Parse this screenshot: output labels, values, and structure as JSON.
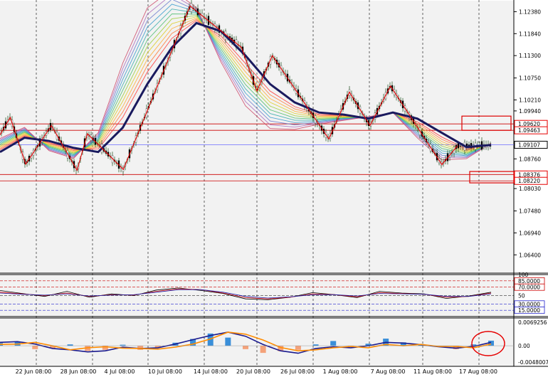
{
  "chart_data": [
    {
      "type": "line",
      "panel": "price",
      "description_layers": [
        "candlestick",
        "moving-average ribbon",
        "zigzag"
      ],
      "x": [
        "22 Jun 08:00",
        "28 Jun 08:00",
        "4 Jul 08:00",
        "10 Jul 08:00",
        "14 Jul 08:00",
        "20 Jul 08:00",
        "26 Jul 08:00",
        "1 Aug 08:00",
        "7 Aug 08:00",
        "11 Aug 08:00",
        "17 Aug 08:00"
      ],
      "ylim": [
        1.0595,
        1.1265
      ],
      "y_ticks": [
        "1.12380",
        "1.11840",
        "1.11300",
        "1.10750",
        "1.10210",
        "1.09940",
        "1.08760",
        "1.08030",
        "1.07480",
        "1.06940",
        "1.06400"
      ],
      "price_labels": [
        "1.09620",
        "1.09463",
        "1.09107",
        "1.08376",
        "1.08220"
      ],
      "current_price": 1.09107,
      "levels": [
        1.0962,
        1.09463,
        1.08376,
        1.0822
      ],
      "zigzag": [
        {
          "t": 0.0,
          "y": 1.0935
        },
        {
          "t": 0.02,
          "y": 1.0978
        },
        {
          "t": 0.05,
          "y": 1.0863
        },
        {
          "t": 0.1,
          "y": 1.0958
        },
        {
          "t": 0.15,
          "y": 1.0848
        },
        {
          "t": 0.17,
          "y": 1.0938
        },
        {
          "t": 0.24,
          "y": 1.085
        },
        {
          "t": 0.37,
          "y": 1.1252
        },
        {
          "t": 0.47,
          "y": 1.115
        },
        {
          "t": 0.5,
          "y": 1.1043
        },
        {
          "t": 0.53,
          "y": 1.113
        },
        {
          "t": 0.64,
          "y": 1.0925
        },
        {
          "t": 0.68,
          "y": 1.104
        },
        {
          "t": 0.72,
          "y": 1.0958
        },
        {
          "t": 0.76,
          "y": 1.1055
        },
        {
          "t": 0.86,
          "y": 1.0862
        },
        {
          "t": 0.89,
          "y": 1.0908
        }
      ],
      "series": [
        {
          "name": "",
          "color": "#1a1a5e",
          "values": [
            1.0893,
            1.0928,
            1.092,
            1.0903,
            1.0893,
            1.0953,
            1.106,
            1.115,
            1.121,
            1.119,
            1.113,
            1.106,
            1.1015,
            1.099,
            1.0985,
            1.0975,
            1.099,
            1.0975,
            1.094,
            1.0905,
            1.091
          ]
        }
      ]
    },
    {
      "type": "line",
      "panel": "oscillator",
      "ylim": [
        0,
        100
      ],
      "y_ticks": [
        "100",
        "85.0000",
        "70.0000",
        "50",
        "30.0000",
        "15.0000"
      ],
      "levels": [
        85,
        70,
        50,
        30,
        15
      ],
      "series": [
        {
          "name": "",
          "color": "#000000",
          "values": [
            62,
            55,
            48,
            60,
            46,
            54,
            50,
            63,
            68,
            62,
            55,
            42,
            40,
            46,
            57,
            52,
            45,
            60,
            56,
            54,
            43,
            49,
            58
          ]
        },
        {
          "name": "",
          "color": "#cc0000",
          "values": [
            58,
            54,
            50,
            56,
            48,
            52,
            51,
            60,
            66,
            64,
            56,
            45,
            42,
            46,
            54,
            52,
            47,
            57,
            55,
            53,
            46,
            48,
            56
          ]
        },
        {
          "name": "",
          "color": "#2222aa",
          "values": [
            56,
            53,
            51,
            54,
            49,
            51,
            52,
            58,
            64,
            64,
            58,
            48,
            44,
            47,
            52,
            52,
            49,
            55,
            54,
            53,
            48,
            48,
            54
          ]
        }
      ]
    },
    {
      "type": "bar",
      "panel": "histogram",
      "ylim": [
        -0.0048007,
        0.0069256
      ],
      "y_ticks": [
        "0.0069256",
        "0.00",
        "-0.0048007"
      ],
      "histogram": [
        0.0008,
        0.0012,
        -0.001,
        -0.0008,
        0.0004,
        -0.0015,
        -0.0012,
        0.0003,
        -0.0012,
        -0.0006,
        0.0009,
        0.002,
        0.0036,
        0.0024,
        -0.001,
        -0.0021,
        -0.0016,
        -0.0012,
        0.0004,
        0.0014,
        -0.0004,
        0.0006,
        0.0021,
        0.001,
        0.0005,
        -0.0002,
        -0.001,
        0.0004,
        0.0015
      ],
      "series": [
        {
          "name": "",
          "color": "#1a1a8e",
          "values": [
            0.001,
            0.0012,
            0.0005,
            -0.0008,
            -0.0012,
            -0.0018,
            -0.0015,
            -0.0004,
            -0.0008,
            -0.0006,
            0.0005,
            0.0018,
            0.003,
            0.004,
            0.0028,
            0.0004,
            -0.0015,
            -0.0022,
            -0.0008,
            -0.0003,
            -0.0006,
            0.0,
            0.001,
            0.0008,
            0.0003,
            -0.0003,
            -0.0007,
            -0.0002,
            0.001
          ]
        },
        {
          "name": "",
          "color": "#ff8c00",
          "values": [
            0.0004,
            0.0005,
            0.001,
            0.0,
            -0.0012,
            -0.0006,
            -0.0003,
            -0.0007,
            -0.0008,
            -0.001,
            -0.0004,
            0.0005,
            0.002,
            0.004,
            0.0034,
            0.0017,
            -0.0005,
            -0.0015,
            -0.0012,
            -0.0006,
            -0.0002,
            -0.0006,
            0.0004,
            0.0,
            0.0004,
            -0.0002,
            -0.0002,
            -0.0006,
            0.0005
          ]
        }
      ]
    }
  ]
}
